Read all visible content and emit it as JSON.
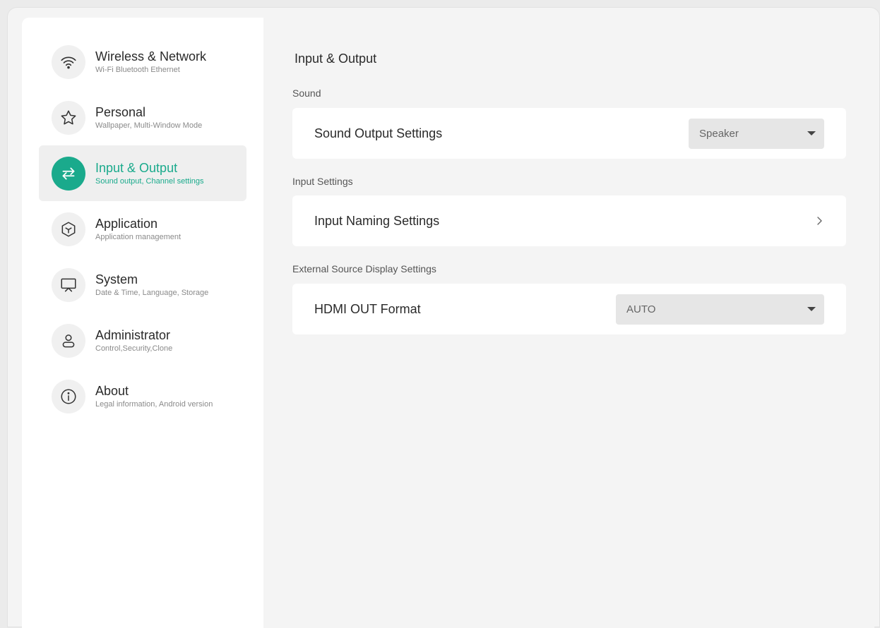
{
  "sidebar": {
    "items": [
      {
        "title": "Wireless & Network",
        "subtitle": "Wi-Fi Bluetooth Ethernet",
        "icon": "wifi-icon"
      },
      {
        "title": "Personal",
        "subtitle": "Wallpaper, Multi-Window Mode",
        "icon": "star-icon"
      },
      {
        "title": "Input & Output",
        "subtitle": "Sound output, Channel settings",
        "icon": "swap-arrows-icon",
        "active": true
      },
      {
        "title": "Application",
        "subtitle": "Application management",
        "icon": "cube-icon"
      },
      {
        "title": "System",
        "subtitle": "Date & Time, Language, Storage",
        "icon": "monitor-icon"
      },
      {
        "title": "Administrator",
        "subtitle": "Control,Security,Clone",
        "icon": "user-icon"
      },
      {
        "title": "About",
        "subtitle": "Legal information, Android version",
        "icon": "info-icon"
      }
    ]
  },
  "main": {
    "title": "Input & Output",
    "sections": {
      "sound": {
        "label": "Sound",
        "row_label": "Sound Output Settings",
        "select_value": "Speaker"
      },
      "input": {
        "label": "Input Settings",
        "row_label": "Input Naming Settings"
      },
      "external": {
        "label": "External Source Display Settings",
        "row_label": "HDMI OUT Format",
        "select_value": "AUTO"
      }
    }
  },
  "colors": {
    "accent": "#1aaa8c",
    "sidebar_bg": "#ffffff",
    "main_bg": "#f4f4f4"
  }
}
